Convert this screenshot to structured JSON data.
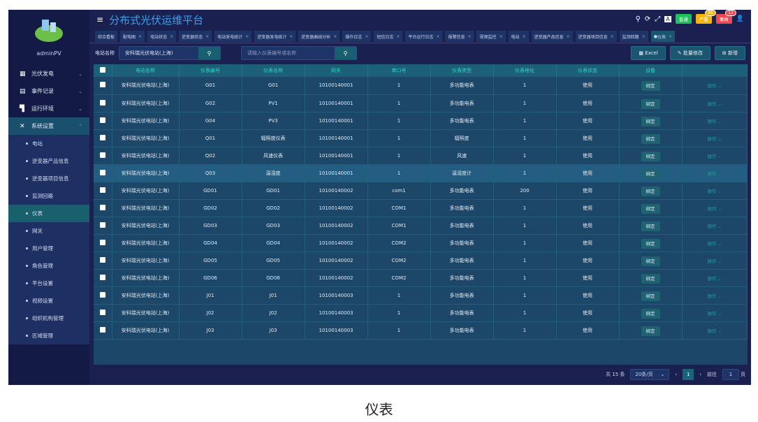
{
  "app": {
    "title": "分布式光伏运维平台",
    "user": "adminPV"
  },
  "header": {
    "badges": [
      {
        "label": "普通",
        "color": "#1fc15a"
      },
      {
        "label": "严重",
        "color": "#f3b40c",
        "count": "96"
      },
      {
        "label": "事故",
        "color": "#ee4850",
        "count": "12"
      }
    ]
  },
  "tabs": [
    "综合看板",
    "配电图",
    "电站状态",
    "逆变器状态",
    "电站发电统计",
    "逆变器发电统计",
    "逆变器曲线分析",
    "操作日志",
    "短信日志",
    "平台运行日志",
    "报警信息",
    "视频监控",
    "电站",
    "逆变器产品信息",
    "逆变器项目信息",
    "监测回路",
    "仪表"
  ],
  "sidebar": {
    "menus": [
      {
        "label": "光伏发电",
        "icon": "grid-icon"
      },
      {
        "label": "事件记录",
        "icon": "document-icon"
      },
      {
        "label": "运行环境",
        "icon": "camera-icon"
      },
      {
        "label": "系统设置",
        "icon": "tools-icon"
      }
    ],
    "sub": [
      "电站",
      "逆变器产品信息",
      "逆变器项目信息",
      "监测回路",
      "仪表",
      "网关",
      "用户管理",
      "角色管理",
      "平台设置",
      "视频设置",
      "组织机构管理",
      "区域管理"
    ]
  },
  "search": {
    "label": "电站名称",
    "station": "安科瑞光伏电站(上海)",
    "placeholder": "请输入仪表编号或名称"
  },
  "actions": {
    "excel": "Excel",
    "batch": "批量修改",
    "add": "新增"
  },
  "table": {
    "headers": [
      "电站名称",
      "仪表编号",
      "仪表名称",
      "网关",
      "串口号",
      "仪表类型",
      "仪表地址",
      "仪表状态",
      "设备"
    ],
    "bind_label": "绑定",
    "op_label": "操作",
    "rows": [
      [
        "安科瑞光伏电站(上海)",
        "G01",
        "G01",
        "10100140001",
        "1",
        "多功能电表",
        "1",
        "使用"
      ],
      [
        "安科瑞光伏电站(上海)",
        "G02",
        "PV1",
        "10100140001",
        "1",
        "多功能电表",
        "1",
        "使用"
      ],
      [
        "安科瑞光伏电站(上海)",
        "G04",
        "PV3",
        "10100140001",
        "1",
        "多功能电表",
        "1",
        "使用"
      ],
      [
        "安科瑞光伏电站(上海)",
        "Q01",
        "辐照度仪表",
        "10100140001",
        "1",
        "辐照度",
        "1",
        "使用"
      ],
      [
        "安科瑞光伏电站(上海)",
        "Q02",
        "风速仪表",
        "10100140001",
        "1",
        "风速",
        "1",
        "使用"
      ],
      [
        "安科瑞光伏电站(上海)",
        "Q03",
        "温湿度",
        "10100140001",
        "1",
        "温湿度计",
        "1",
        "使用"
      ],
      [
        "安科瑞光伏电站(上海)",
        "GD01",
        "GD01",
        "10100140002",
        "com1",
        "多功能电表",
        "200",
        "使用"
      ],
      [
        "安科瑞光伏电站(上海)",
        "GD02",
        "GD02",
        "10100140002",
        "COM1",
        "多功能电表",
        "1",
        "使用"
      ],
      [
        "安科瑞光伏电站(上海)",
        "GD03",
        "GD03",
        "10100140002",
        "COM1",
        "多功能电表",
        "1",
        "使用"
      ],
      [
        "安科瑞光伏电站(上海)",
        "GD04",
        "GD04",
        "10100140002",
        "COM2",
        "多功能电表",
        "1",
        "使用"
      ],
      [
        "安科瑞光伏电站(上海)",
        "GD05",
        "GD05",
        "10100140002",
        "COM2",
        "多功能电表",
        "1",
        "使用"
      ],
      [
        "安科瑞光伏电站(上海)",
        "GD06",
        "GD06",
        "10100140002",
        "COM2",
        "多功能电表",
        "1",
        "使用"
      ],
      [
        "安科瑞光伏电站(上海)",
        "J01",
        "J01",
        "10100140003",
        "1",
        "多功能电表",
        "1",
        "使用"
      ],
      [
        "安科瑞光伏电站(上海)",
        "J02",
        "J02",
        "10100140003",
        "1",
        "多功能电表",
        "1",
        "使用"
      ],
      [
        "安科瑞光伏电站(上海)",
        "J03",
        "J03",
        "10100140003",
        "1",
        "多功能电表",
        "1",
        "使用"
      ]
    ]
  },
  "pager": {
    "total": "共 15 条",
    "size": "20条/页",
    "page": "1",
    "goto": "前往",
    "goto_value": "1",
    "unit": "页"
  },
  "caption": "仪表"
}
